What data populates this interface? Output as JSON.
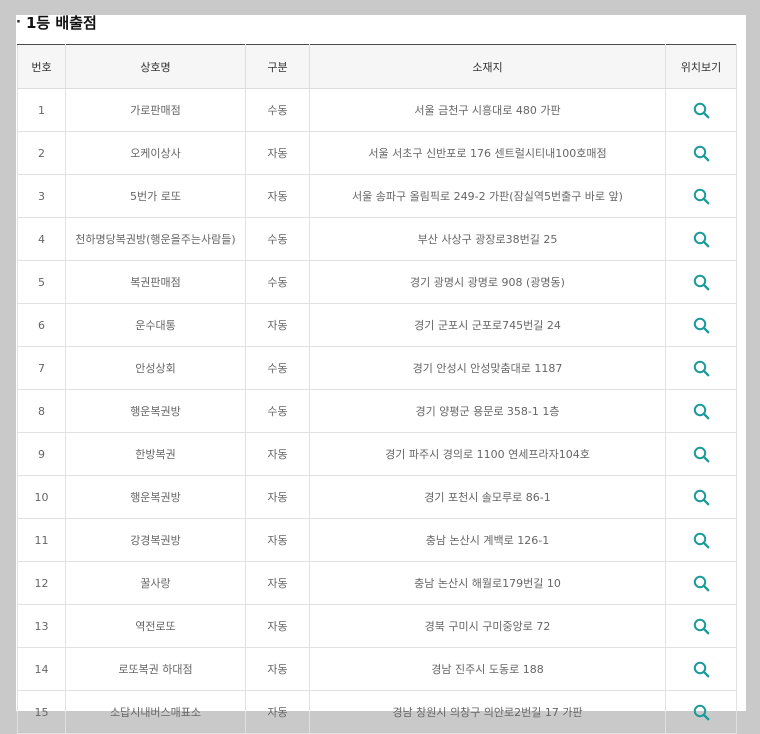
{
  "section_title": "1등 배출점",
  "columns": [
    "번호",
    "상호명",
    "구분",
    "소재지",
    "위치보기"
  ],
  "rows": [
    {
      "no": "1",
      "name": "가로판매점",
      "type": "수동",
      "address": "서울 금천구 시흥대로 480 가판"
    },
    {
      "no": "2",
      "name": "오케이상사",
      "type": "자동",
      "address": "서울 서초구 신반포로 176 센트럴시티내100호매점"
    },
    {
      "no": "3",
      "name": "5번가 로또",
      "type": "자동",
      "address": "서울 송파구 올림픽로 249-2 가판(잠실역5번출구 바로 앞)"
    },
    {
      "no": "4",
      "name": "천하명당복권방(행운을주는사람들)",
      "type": "수동",
      "address": "부산 사상구 광장로38번길 25"
    },
    {
      "no": "5",
      "name": "복권판매점",
      "type": "수동",
      "address": "경기 광명시 광명로 908 (광명동)"
    },
    {
      "no": "6",
      "name": "운수대통",
      "type": "자동",
      "address": "경기 군포시 군포로745번길 24"
    },
    {
      "no": "7",
      "name": "안성상회",
      "type": "수동",
      "address": "경기 안성시 안성맞춤대로 1187"
    },
    {
      "no": "8",
      "name": "행운복권방",
      "type": "수동",
      "address": "경기 양평군 용문로 358-1 1층"
    },
    {
      "no": "9",
      "name": "한방복권",
      "type": "자동",
      "address": "경기 파주시 경의로 1100 연세프라자104호"
    },
    {
      "no": "10",
      "name": "행운복권방",
      "type": "자동",
      "address": "경기 포천시 솔모루로 86-1"
    },
    {
      "no": "11",
      "name": "강경복권방",
      "type": "자동",
      "address": "충남 논산시 계백로 126-1"
    },
    {
      "no": "12",
      "name": "꿀사랑",
      "type": "자동",
      "address": "충남 논산시 해월로179번길 10"
    },
    {
      "no": "13",
      "name": "역전로또",
      "type": "자동",
      "address": "경북 구미시 구미중앙로 72"
    },
    {
      "no": "14",
      "name": "로또복권 하대점",
      "type": "자동",
      "address": "경남 진주시 도동로 188"
    },
    {
      "no": "15",
      "name": "소답시내버스매표소",
      "type": "자동",
      "address": "경남 창원시 의창구 의안로2번길 17 가판"
    }
  ],
  "icons": {
    "location": "search-icon"
  },
  "colors": {
    "icon": "#1a9a9a",
    "header_border": "#4a4a4a",
    "page_bg": "#c9c9c9"
  }
}
